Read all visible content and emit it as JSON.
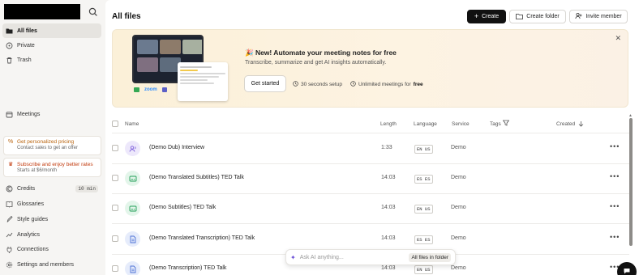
{
  "sidebar": {
    "items": [
      {
        "label": "All files",
        "icon": "folder-icon",
        "active": true
      },
      {
        "label": "Private",
        "icon": "lock-icon"
      },
      {
        "label": "Trash",
        "icon": "trash-icon"
      },
      {
        "label": "Meetings",
        "icon": "calendar-icon"
      }
    ],
    "promos": [
      {
        "title": "Get personalized pricing",
        "subtitle": "Contact sales to get an offer",
        "icon": "percent-icon"
      },
      {
        "title": "Subscribe and enjoy better rates",
        "subtitle": "Starts at $6/month",
        "icon": "crown-icon"
      }
    ],
    "bottom_items": [
      {
        "label": "Credits",
        "icon": "credits-icon",
        "badge": "10 min"
      },
      {
        "label": "Glossaries",
        "icon": "book-icon"
      },
      {
        "label": "Style guides",
        "icon": "style-icon"
      },
      {
        "label": "Analytics",
        "icon": "chart-icon"
      },
      {
        "label": "Connections",
        "icon": "plug-icon"
      },
      {
        "label": "Settings and members",
        "icon": "gear-icon"
      }
    ]
  },
  "header": {
    "title": "All files",
    "create_label": "Create",
    "create_folder_label": "Create folder",
    "invite_label": "Invite member"
  },
  "banner": {
    "title": "🎉 New! Automate your meeting notes for free",
    "subtitle": "Transcribe, summarize and get AI insights automatically.",
    "cta": "Get started",
    "meta1": "30 seconds setup",
    "meta2_prefix": "Unlimited meetings for",
    "meta2_bold": "free",
    "brand": "zoom"
  },
  "table": {
    "headers": {
      "name": "Name",
      "length": "Length",
      "language": "Language",
      "service": "Service",
      "tags": "Tags",
      "created": "Created"
    },
    "rows": [
      {
        "name": "(Demo Dub) Interview",
        "length": "1:33",
        "language": "EN US",
        "service": "Demo",
        "type": "dub"
      },
      {
        "name": "(Demo Translated Subtitles) TED Talk",
        "length": "14:03",
        "language": "ES ES",
        "service": "Demo",
        "type": "subtitle"
      },
      {
        "name": "(Demo Subtitles) TED Talk",
        "length": "14:03",
        "language": "EN US",
        "service": "Demo",
        "type": "subtitle"
      },
      {
        "name": "(Demo Translated Transcription) TED Talk",
        "length": "14:03",
        "language": "ES ES",
        "service": "Demo",
        "type": "transcript"
      },
      {
        "name": "(Demo Transcription) TED Talk",
        "length": "14:03",
        "language": "EN US",
        "service": "Demo",
        "type": "transcript"
      }
    ]
  },
  "ai_bar": {
    "placeholder": "Ask AI anything...",
    "scope": "All files in folder"
  },
  "colors": {
    "accent": "#111111",
    "dub": "#7c5cdb",
    "subtitle": "#1f9d55",
    "transcript": "#4a6fd6"
  }
}
